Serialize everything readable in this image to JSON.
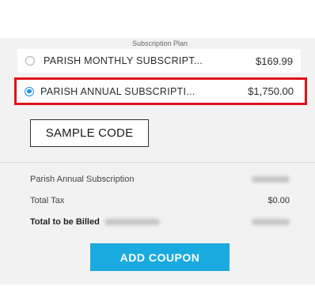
{
  "subscription_plan": {
    "heading": "Subscription Plan",
    "options": [
      {
        "name": "PARISH MONTHLY SUBSCRIPT...",
        "price": "$169.99",
        "selected": false
      },
      {
        "name": "PARISH ANNUAL SUBSCRIPTI...",
        "price": "$1,750.00",
        "selected": true
      }
    ]
  },
  "highlight_color": "#e0101a",
  "radio_accent_color": "#1e90e6",
  "sample_code_label": "SAMPLE CODE",
  "summary": {
    "subscription_label": "Parish Annual Subscription",
    "tax_label": "Total Tax",
    "tax_value": "$0.00",
    "total_label": "Total to be Billed"
  },
  "add_coupon": {
    "label": "ADD COUPON",
    "color": "#19aadf"
  }
}
